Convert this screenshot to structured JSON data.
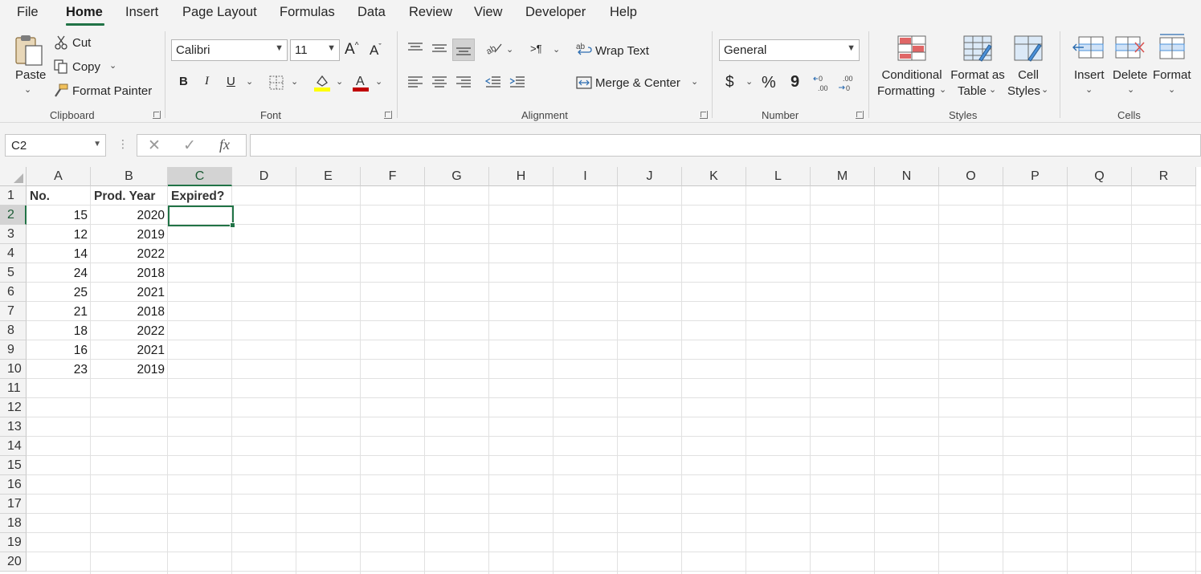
{
  "menu": {
    "tabs": [
      "File",
      "Home",
      "Insert",
      "Page Layout",
      "Formulas",
      "Data",
      "Review",
      "View",
      "Developer",
      "Help"
    ],
    "active": "Home"
  },
  "ribbon": {
    "clipboard": {
      "paste": "Paste",
      "cut": "Cut",
      "copy": "Copy",
      "format_painter": "Format Painter",
      "label": "Clipboard"
    },
    "font": {
      "family": "Calibri",
      "size": "11",
      "bold": "B",
      "italic": "I",
      "underline": "U",
      "label": "Font"
    },
    "alignment": {
      "wrap_text": "Wrap Text",
      "merge_center": "Merge & Center",
      "label": "Alignment"
    },
    "number": {
      "format": "General",
      "currency": "$",
      "percent": "%",
      "comma": "9",
      "label": "Number"
    },
    "styles": {
      "conditional": [
        "Conditional",
        "Formatting"
      ],
      "format_table": [
        "Format as",
        "Table"
      ],
      "cell_styles": [
        "Cell",
        "Styles"
      ],
      "label": "Styles"
    },
    "cells": {
      "insert": "Insert",
      "delete": "Delete",
      "format": "Format",
      "label": "Cells"
    }
  },
  "formula_bar": {
    "name_box": "C2",
    "fx": "fx",
    "content": ""
  },
  "colors": {
    "accent": "#217346",
    "font_color": "#c00000",
    "highlight": "#ffff00"
  },
  "sheet": {
    "columns": [
      "A",
      "B",
      "C",
      "D",
      "E",
      "F",
      "G",
      "H",
      "I",
      "J",
      "K",
      "L",
      "M",
      "N",
      "O",
      "P",
      "Q",
      "R"
    ],
    "rows": [
      "1",
      "2",
      "3",
      "4",
      "5",
      "6",
      "7",
      "8",
      "9",
      "10",
      "11",
      "12",
      "13",
      "14",
      "15",
      "16",
      "17",
      "18",
      "19",
      "20"
    ],
    "selected_cell": "C2",
    "headers": [
      "No.",
      "Prod. Year",
      "Expired?"
    ],
    "data": [
      [
        "15",
        "2020"
      ],
      [
        "12",
        "2019"
      ],
      [
        "14",
        "2022"
      ],
      [
        "24",
        "2018"
      ],
      [
        "25",
        "2021"
      ],
      [
        "21",
        "2018"
      ],
      [
        "18",
        "2022"
      ],
      [
        "16",
        "2021"
      ],
      [
        "23",
        "2019"
      ]
    ]
  }
}
